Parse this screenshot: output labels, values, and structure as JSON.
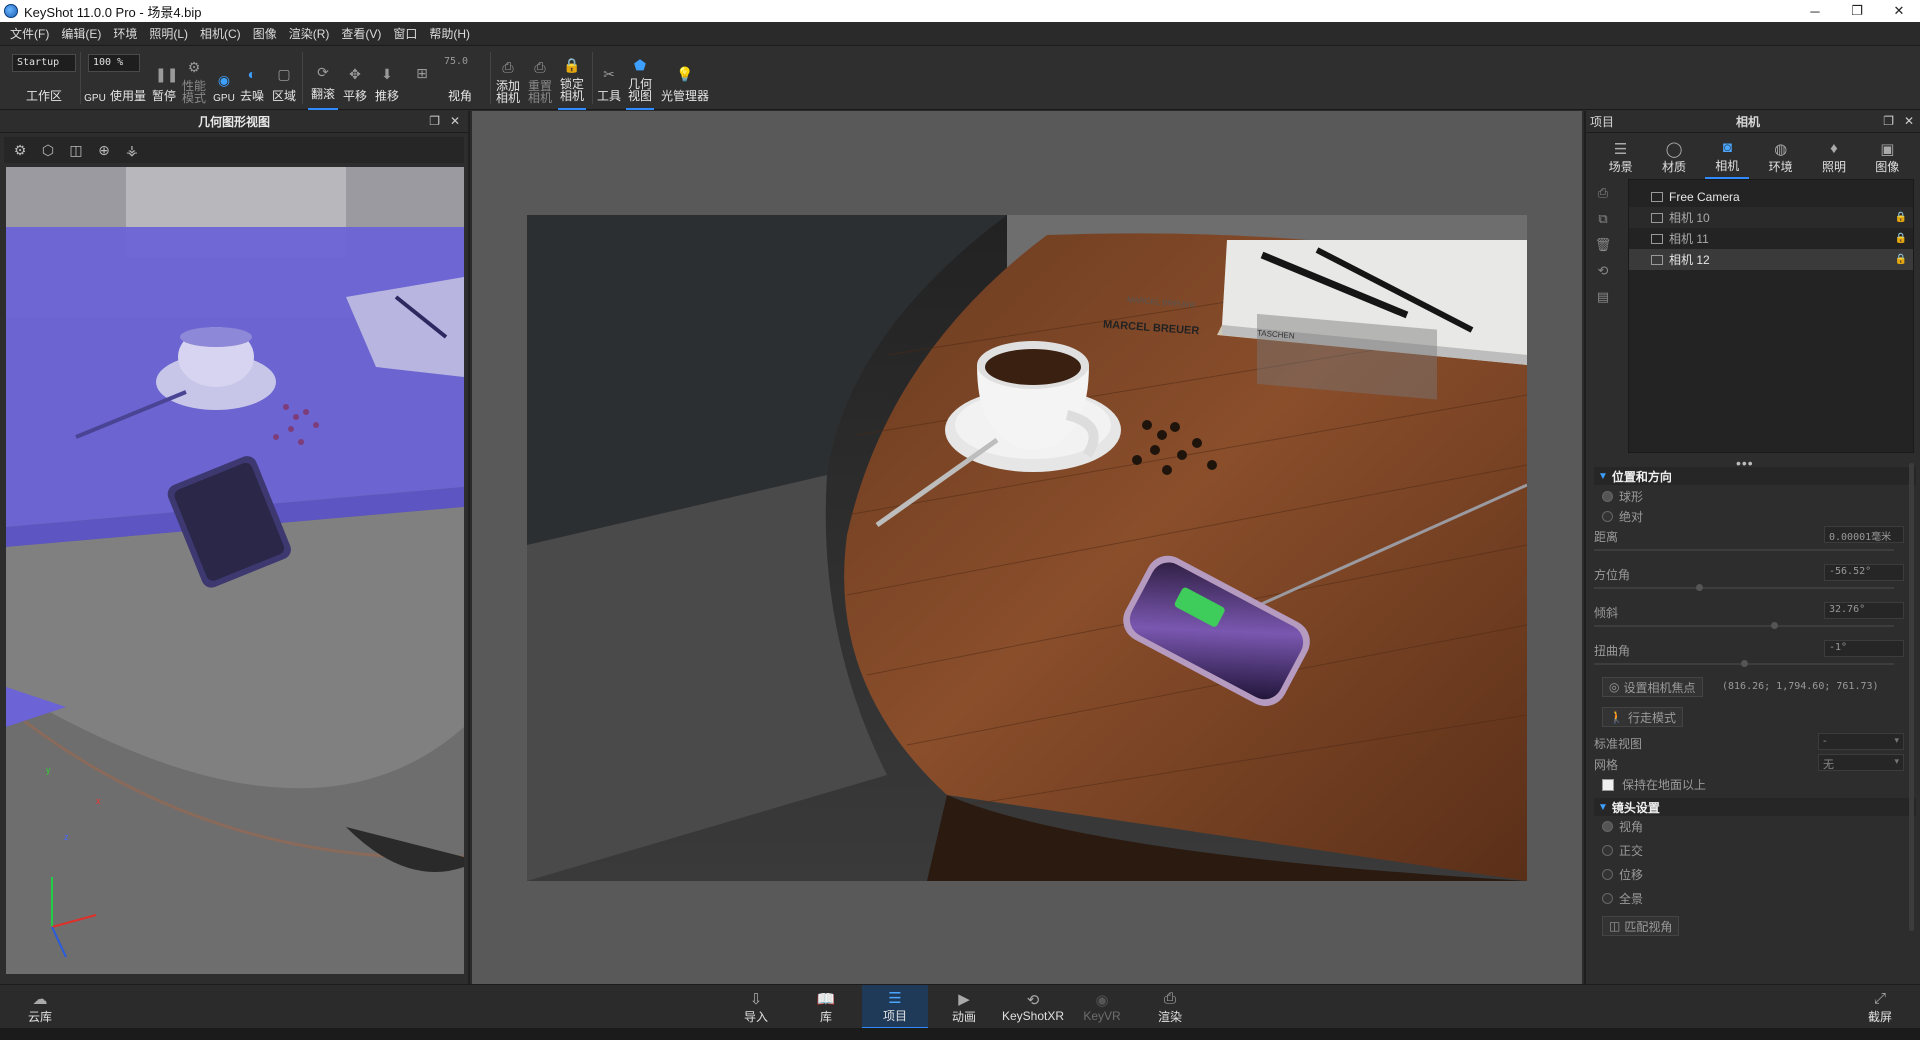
{
  "titlebar": {
    "title": "KeyShot 11.0.0 Pro  - 场景4.bip",
    "min": "─",
    "max": "❐",
    "close": "✕"
  },
  "menu": [
    "文件(F)",
    "编辑(E)",
    "环境",
    "照明(L)",
    "相机(C)",
    "图像",
    "渲染(R)",
    "查看(V)",
    "窗口",
    "帮助(H)"
  ],
  "toolbar": {
    "workspace_value": "Startup",
    "workspace_label": "工作区",
    "usage_value": "100 %",
    "gpu_label": "GPU",
    "usage_label": "使用量",
    "pause_label": "暂停",
    "perf_label": "性能\n模式",
    "gpu_btn_label": "GPU",
    "denoise_label": "去噪",
    "region_label": "区域",
    "tumble_label": "翻滚",
    "pan_label": "平移",
    "dolly_label": "推移",
    "fov_value": "75.0",
    "fov_label": "视角",
    "add_cam_label": "添加\n相机",
    "reset_cam_label": "重置\n相机",
    "lock_cam_label": "锁定\n相机",
    "tools_label": "工具",
    "geo_view_label": "几何\n视图",
    "light_mgr_label": "光管理器"
  },
  "left_panel": {
    "title": "几何图形视图",
    "axes": {
      "x": "x",
      "y": "y",
      "z": "z"
    }
  },
  "right_panel": {
    "title_left": "项目",
    "title_center": "相机",
    "tabs": [
      {
        "label": "场景",
        "icon": "scene-icon"
      },
      {
        "label": "材质",
        "icon": "material-icon"
      },
      {
        "label": "相机",
        "icon": "camera-icon"
      },
      {
        "label": "环境",
        "icon": "environment-icon"
      },
      {
        "label": "照明",
        "icon": "lighting-icon"
      },
      {
        "label": "图像",
        "icon": "image-icon"
      }
    ],
    "cameras": [
      {
        "name": "Free Camera",
        "locked": false
      },
      {
        "name": "相机 10",
        "locked": true
      },
      {
        "name": "相机 11",
        "locked": true
      },
      {
        "name": "相机 12",
        "locked": true
      }
    ],
    "pos_section": "位置和方向",
    "spherical": "球形",
    "absolute": "绝对",
    "distance_label": "距离",
    "distance_value": "0.00001毫米",
    "azimuth_label": "方位角",
    "azimuth_value": "-56.52°",
    "azimuth_level": 0.34,
    "incl_label": "倾斜",
    "incl_value": "32.76°",
    "incl_level": 0.59,
    "twist_label": "扭曲角",
    "twist_value": "-1°",
    "twist_level": 0.49,
    "focus_btn": "设置相机焦点",
    "focus_coords": "(816.26; 1,794.60; 761.73)",
    "walk_btn": "行走模式",
    "std_view_label": "标准视图",
    "std_view_value": "-",
    "grid_label": "网格",
    "grid_value": "无",
    "keep_ground": "保持在地面以上",
    "lens_section": "镜头设置",
    "lens_persp": "视角",
    "lens_ortho": "正交",
    "lens_shift": "位移",
    "lens_pano": "全景",
    "match_btn": "匹配视角"
  },
  "render": {
    "book_title": "MARCEL BREUER",
    "book_publisher": "TASCHEN",
    "book_cover_text": "MARCEL BREUER"
  },
  "bottom": {
    "cloud": "云库",
    "import": "导入",
    "library": "库",
    "project": "项目",
    "animation": "动画",
    "keyshotxr": "KeyShotXR",
    "keyvr": "KeyVR",
    "render": "渲染",
    "screenshot": "截屏"
  }
}
